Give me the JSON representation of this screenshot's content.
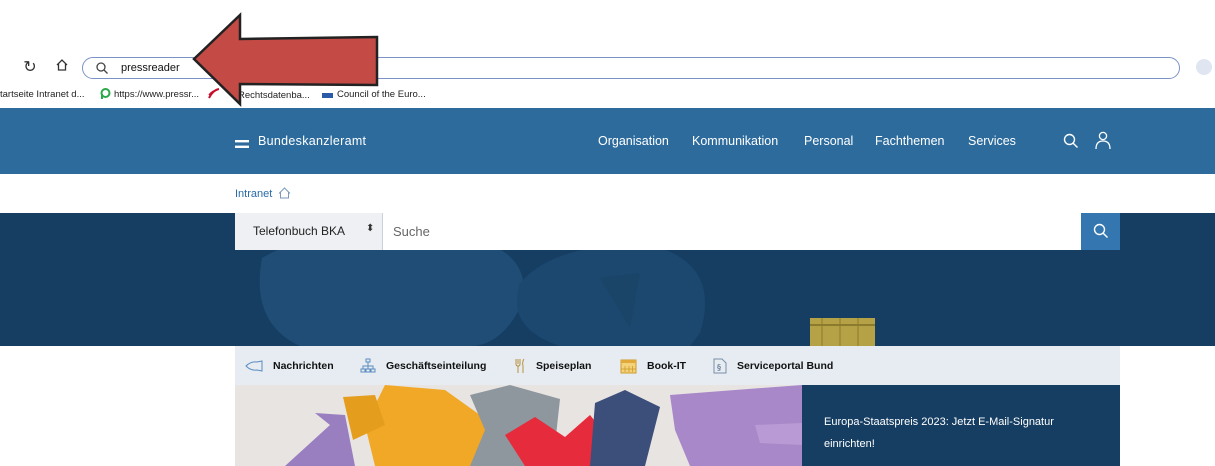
{
  "browser": {
    "address_value": "pressreader",
    "bookmarks": [
      {
        "label": "tartseite Intranet d..."
      },
      {
        "label": "https://www.pressr..."
      },
      {
        "label": "Rechtsdatenba..."
      },
      {
        "label": "Council of the Euro..."
      }
    ]
  },
  "header": {
    "logo_text": "Bundeskanzleramt",
    "nav": [
      "Organisation",
      "Kommunikation",
      "Personal",
      "Fachthemen",
      "Services"
    ]
  },
  "breadcrumb": {
    "label": "Intranet"
  },
  "search": {
    "select_value": "Telefonbuch BKA",
    "placeholder": "Suche"
  },
  "quicklinks": [
    {
      "label": "Nachrichten",
      "icon": "megaphone-icon"
    },
    {
      "label": "Geschäftseinteilung",
      "icon": "org-chart-icon"
    },
    {
      "label": "Speiseplan",
      "icon": "cutlery-icon"
    },
    {
      "label": "Book-IT",
      "icon": "calendar-icon"
    },
    {
      "label": "Serviceportal Bund",
      "icon": "document-paragraph-icon"
    }
  ],
  "teaser": {
    "text": "Europa-Staatspreis 2023: Jetzt E-Mail-Signatur einrichten!"
  },
  "colors": {
    "header_bg": "#2c6b9c",
    "banner_bg": "#163e63",
    "quicklinks_bg": "#e6ecf2",
    "annotation_arrow": "#c44a45"
  }
}
